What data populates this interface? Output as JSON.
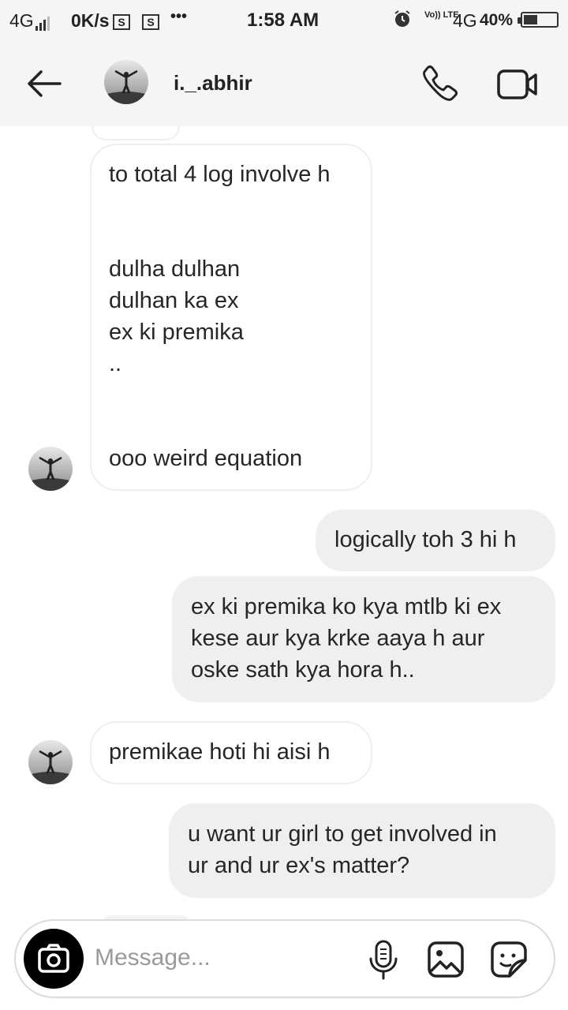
{
  "status_bar": {
    "network": "4G",
    "speed": "0K/s",
    "notif_1": "S",
    "notif_2": "S",
    "more": "•••",
    "time": "1:58 AM",
    "volte": "Vo)) LTE",
    "network_2": "4G",
    "battery": "40%"
  },
  "header": {
    "username": "i._.abhir",
    "back_icon": "arrow-left-icon",
    "call_icon": "phone-icon",
    "video_icon": "video-camera-icon"
  },
  "messages": [
    {
      "sender": "them",
      "text": "to total 4 log involve h\n\n\ndulha dulhan\ndulhan ka ex\nex ki premika\n..\n\n\nooo weird equation",
      "show_avatar": true
    },
    {
      "sender": "me",
      "text": "logically toh 3 hi h"
    },
    {
      "sender": "me",
      "text": "ex ki premika ko kya mtlb ki ex\nkese aur kya krke aaya h aur\noske sath kya hora h.."
    },
    {
      "sender": "them",
      "text": "premikae hoti hi aisi h",
      "show_avatar": true
    },
    {
      "sender": "me",
      "text": "u want ur girl to get involved in\nur and ur ex's matter?"
    }
  ],
  "composer": {
    "placeholder": "Message...",
    "camera_icon": "camera-icon",
    "mic_icon": "microphone-icon",
    "gallery_icon": "image-icon",
    "sticker_icon": "sticker-icon"
  },
  "colors": {
    "header_bg": "#f5f5f5",
    "outgoing_bubble": "#efefef",
    "incoming_border": "#efefef",
    "text": "#262626"
  }
}
